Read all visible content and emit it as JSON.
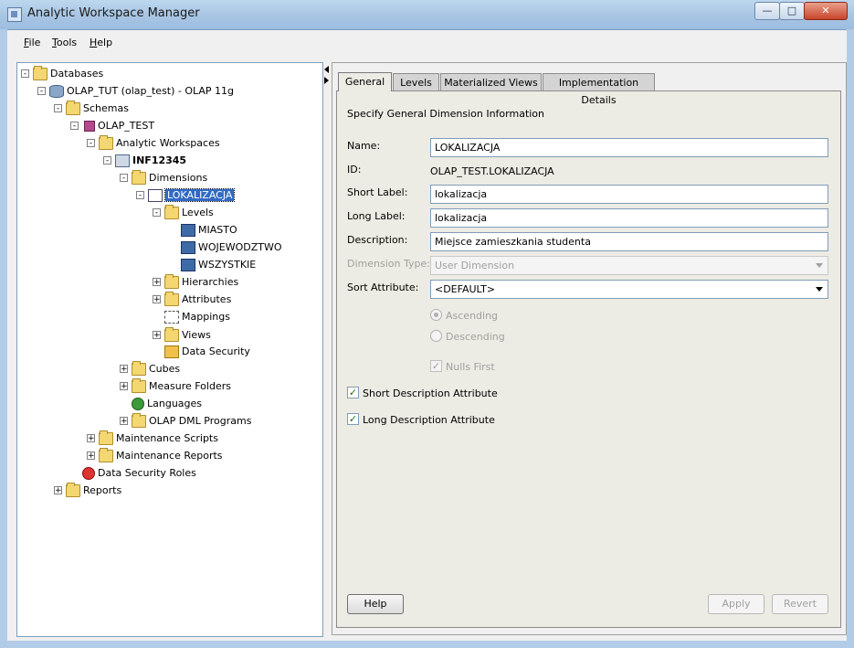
{
  "window": {
    "title": "Analytic Workspace Manager"
  },
  "menu": [
    {
      "label": "File",
      "mnemonic": "F",
      "rest": "ile"
    },
    {
      "label": "Tools",
      "mnemonic": "T",
      "rest": "ools"
    },
    {
      "label": "Help",
      "mnemonic": "H",
      "rest": "elp"
    }
  ],
  "tree": [
    {
      "label": "Databases",
      "icon": "databases-folder-icon",
      "expander": "-"
    },
    {
      "label": "OLAP_TUT (olap_test) - OLAP 11g",
      "icon": "database-connection-icon",
      "expander": "-"
    },
    {
      "label": "Schemas",
      "icon": "schemas-folder-icon",
      "expander": "-"
    },
    {
      "label": "OLAP_TEST",
      "icon": "schema-icon",
      "expander": "-"
    },
    {
      "label": "Analytic Workspaces",
      "icon": "analytic-workspaces-folder-icon",
      "expander": "-"
    },
    {
      "label": "INF12345",
      "icon": "analytic-workspace-icon",
      "expander": "-"
    },
    {
      "label": "Dimensions",
      "icon": "dimensions-folder-icon",
      "expander": "-"
    },
    {
      "label": "LOKALIZACJA",
      "icon": "dimension-icon",
      "expander": "-"
    },
    {
      "label": "Levels",
      "icon": "levels-folder-icon",
      "expander": "-"
    },
    {
      "label": "MIASTO",
      "icon": "level-icon",
      "expander": ""
    },
    {
      "label": "WOJEWODZTWO",
      "icon": "level-icon",
      "expander": ""
    },
    {
      "label": "WSZYSTKIE",
      "icon": "level-icon",
      "expander": ""
    },
    {
      "label": "Hierarchies",
      "icon": "hierarchies-folder-icon",
      "expander": "+"
    },
    {
      "label": "Attributes",
      "icon": "attributes-folder-icon",
      "expander": "+"
    },
    {
      "label": "Mappings",
      "icon": "mappings-icon",
      "expander": ""
    },
    {
      "label": "Views",
      "icon": "views-folder-icon",
      "expander": "+"
    },
    {
      "label": "Data Security",
      "icon": "data-security-icon",
      "expander": ""
    },
    {
      "label": "Cubes",
      "icon": "cubes-folder-icon",
      "expander": "+"
    },
    {
      "label": "Measure Folders",
      "icon": "measure-folders-icon",
      "expander": "+"
    },
    {
      "label": "Languages",
      "icon": "languages-globe-icon",
      "expander": ""
    },
    {
      "label": "OLAP DML Programs",
      "icon": "olap-dml-programs-folder-icon",
      "expander": "+"
    },
    {
      "label": "Maintenance Scripts",
      "icon": "maintenance-scripts-folder-icon",
      "expander": "+"
    },
    {
      "label": "Maintenance Reports",
      "icon": "maintenance-reports-folder-icon",
      "expander": "+"
    },
    {
      "label": "Data Security Roles",
      "icon": "data-security-roles-icon",
      "expander": ""
    },
    {
      "label": "Reports",
      "icon": "reports-folder-icon",
      "expander": "+"
    }
  ],
  "tabs": [
    "General",
    "Levels",
    "Materialized Views",
    "Implementation Details"
  ],
  "form": {
    "heading": "Specify General Dimension Information",
    "name_label": "Name:",
    "name_value": "LOKALIZACJA",
    "id_label": "ID:",
    "id_value": "OLAP_TEST.LOKALIZACJA",
    "short_label_label": "Short Label:",
    "short_label_value": "lokalizacja",
    "long_label_label": "Long Label:",
    "long_label_value": "lokalizacja",
    "description_label": "Description:",
    "description_value": "Miejsce zamieszkania studenta",
    "dimension_type_label": "Dimension Type:",
    "dimension_type_value": "User Dimension",
    "sort_attribute_label": "Sort Attribute:",
    "sort_attribute_value": "<DEFAULT>",
    "ascending_label": "Ascending",
    "descending_label": "Descending",
    "nulls_first_label": "Nulls First",
    "short_desc_attr_label": "Short Description Attribute",
    "long_desc_attr_label": "Long Description Attribute"
  },
  "buttons": {
    "help": "Help",
    "apply": "Apply",
    "revert": "Revert"
  }
}
